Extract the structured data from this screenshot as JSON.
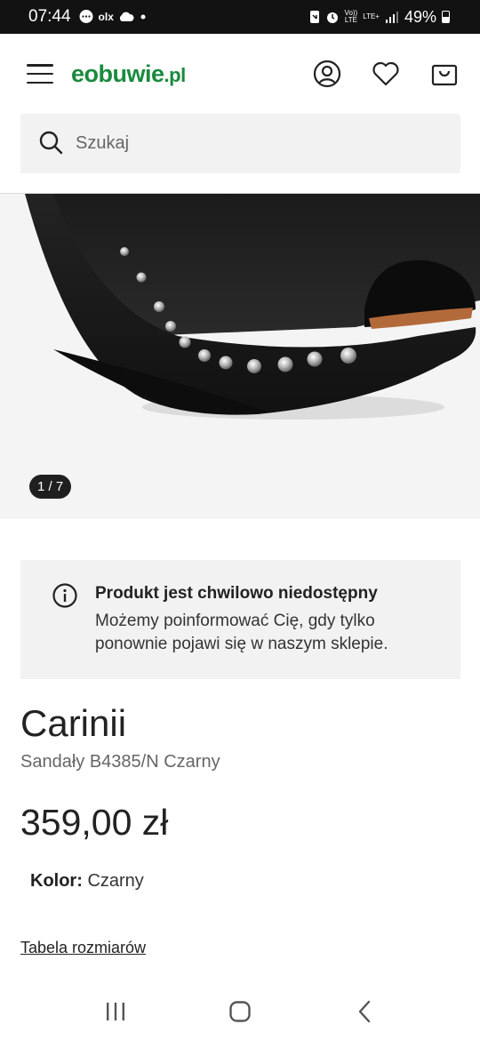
{
  "status_bar": {
    "time": "07:44",
    "notifications": [
      "chat-bubble-icon",
      "olx-icon",
      "cloud-icon",
      "dot-icon"
    ],
    "olx_label": "olx",
    "volte_label": "Vo))\nLTE",
    "network_label": "LTE+",
    "battery": "49%"
  },
  "header": {
    "logo_main": "eobuwie",
    "logo_suffix": ".pl",
    "brand_color": "#1a8a3e"
  },
  "search": {
    "placeholder": "Szukaj"
  },
  "gallery": {
    "counter": "1 / 7"
  },
  "notice": {
    "title": "Produkt jest chwilowo niedostępny",
    "body": "Możemy poinformować Cię, gdy tylko ponownie pojawi się w naszym sklepie."
  },
  "product": {
    "brand": "Carinii",
    "name": "Sandały B4385/N Czarny",
    "price": "359,00 zł",
    "color_label": "Kolor:",
    "color_value": "Czarny",
    "size_table_link": "Tabela rozmiarów"
  },
  "nav": [
    "recents-icon",
    "home-icon",
    "back-icon"
  ]
}
